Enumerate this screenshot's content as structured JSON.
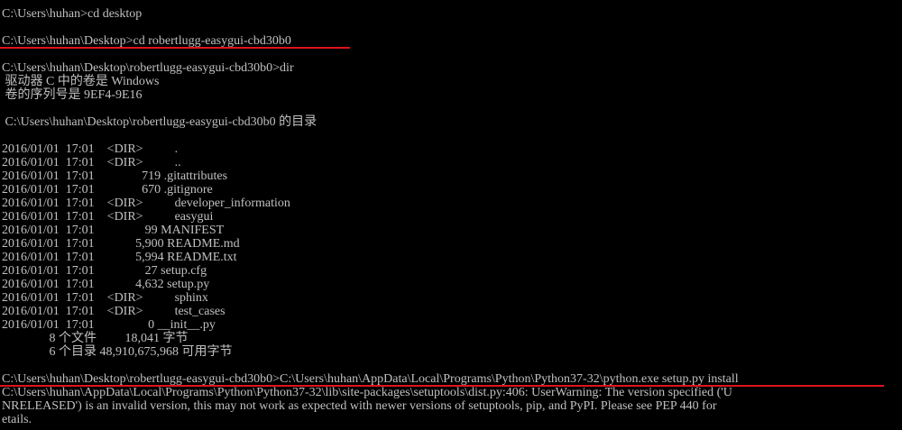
{
  "colors": {
    "background": "#000000",
    "text": "#c0c0c0",
    "highlight_underline": "#e0141b"
  },
  "terminal": {
    "lines": [
      "C:\\Users\\huhan>cd desktop",
      "",
      "C:\\Users\\huhan\\Desktop>cd robertlugg-easygui-cbd30b0",
      "",
      "C:\\Users\\huhan\\Desktop\\robertlugg-easygui-cbd30b0>dir",
      " 驱动器 C 中的卷是 Windows",
      " 卷的序列号是 9EF4-9E16",
      "",
      " C:\\Users\\huhan\\Desktop\\robertlugg-easygui-cbd30b0 的目录",
      "",
      "2016/01/01  17:01    <DIR>          .",
      "2016/01/01  17:01    <DIR>          ..",
      "2016/01/01  17:01               719 .gitattributes",
      "2016/01/01  17:01               670 .gitignore",
      "2016/01/01  17:01    <DIR>          developer_information",
      "2016/01/01  17:01    <DIR>          easygui",
      "2016/01/01  17:01                99 MANIFEST",
      "2016/01/01  17:01             5,900 README.md",
      "2016/01/01  17:01             5,994 README.txt",
      "2016/01/01  17:01                27 setup.cfg",
      "2016/01/01  17:01             4,632 setup.py",
      "2016/01/01  17:01    <DIR>          sphinx",
      "2016/01/01  17:01    <DIR>          test_cases",
      "2016/01/01  17:01                 0 __init__.py",
      "               8 个文件         18,041 字节",
      "               6 个目录 48,910,675,968 可用字节",
      "",
      "C:\\Users\\huhan\\Desktop\\robertlugg-easygui-cbd30b0>C:\\Users\\huhan\\AppData\\Local\\Programs\\Python\\Python37-32\\python.exe setup.py install",
      "C:\\Users\\huhan\\AppData\\Local\\Programs\\Python\\Python37-32\\lib\\site-packages\\setuptools\\dist.py:406: UserWarning: The version specified ('U",
      "NRELEASED') is an invalid version, this may not work as expected with newer versions of setuptools, pip, and PyPI. Please see PEP 440 for",
      "etails."
    ]
  }
}
